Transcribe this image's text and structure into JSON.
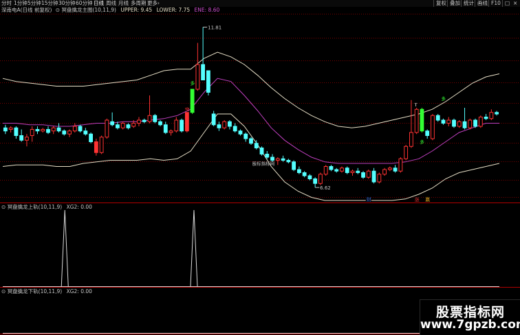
{
  "toolbar": {
    "periods": [
      "分时",
      "1分钟",
      "5分钟",
      "15分钟",
      "30分钟",
      "60分钟",
      "日线",
      "周线",
      "月线",
      "多周期",
      "更多"
    ],
    "active_period": "日线",
    "more_arrow": "›",
    "actions": [
      "复权",
      "叠加",
      "统计",
      "画线",
      "F10"
    ],
    "window_controls": [
      "□",
      "×"
    ]
  },
  "main_panel": {
    "stock_label": "深南电A(日线 前复权)",
    "indicator_name": "冥盘擒龙主图(10,11,9)",
    "upper_label": "UPPER: 9.45",
    "lower_label": "LOWER: 7.75",
    "ene_label": "ENE: 8.60",
    "high_annotation": "11.81",
    "low_annotation": "6.62",
    "watermark_in_chart": "股标指标网",
    "signal_labels": [
      {
        "text": "多",
        "color": "#33ff33"
      },
      {
        "text": "空",
        "color": "#ff3333"
      },
      {
        "text": "多",
        "color": "#33ff33"
      },
      {
        "text": "T",
        "color": "#ffffff"
      },
      {
        "text": "多",
        "color": "#33ff33"
      }
    ],
    "bottom_markers": [
      {
        "text": "财",
        "color": "#3b6dd6"
      },
      {
        "text": "涨",
        "color": "#e03030"
      },
      {
        "text": "赢",
        "color": "#e0a020"
      }
    ]
  },
  "sub_panel_1": {
    "title": "冥盘擒龙上轨(10,11,9)",
    "value_label": "XG2: 0.00"
  },
  "sub_panel_2": {
    "title": "冥盘擒龙下轨(10,11,9)",
    "value_label": "XG2: 0.00"
  },
  "colors": {
    "up": "#ff3333",
    "down": "#54ffff",
    "signal_up": "#33ff33",
    "band": "#e8e0c8",
    "ene": "#c040c0",
    "grid": "#8b0000"
  },
  "watermark": {
    "line1": "股票指标网",
    "line2": "www.7gpzb.com"
  },
  "chart_data": {
    "type": "candlestick",
    "price_range": [
      6.2,
      12.2
    ],
    "high_marker": 11.81,
    "low_marker": 6.62,
    "candles": [
      {
        "o": 8.55,
        "h": 8.65,
        "l": 8.35,
        "c": 8.45
      },
      {
        "o": 8.5,
        "h": 8.6,
        "l": 8.4,
        "c": 8.55
      },
      {
        "o": 8.55,
        "h": 8.6,
        "l": 8.2,
        "c": 8.3
      },
      {
        "o": 8.3,
        "h": 8.5,
        "l": 8.1,
        "c": 8.15
      },
      {
        "o": 8.15,
        "h": 8.35,
        "l": 7.95,
        "c": 8.25
      },
      {
        "o": 8.3,
        "h": 8.6,
        "l": 8.1,
        "c": 8.5
      },
      {
        "o": 8.5,
        "h": 8.6,
        "l": 8.35,
        "c": 8.45
      },
      {
        "o": 8.45,
        "h": 8.55,
        "l": 8.4,
        "c": 8.5
      },
      {
        "o": 8.5,
        "h": 8.6,
        "l": 8.35,
        "c": 8.4
      },
      {
        "o": 8.45,
        "h": 8.6,
        "l": 8.35,
        "c": 8.55
      },
      {
        "o": 8.55,
        "h": 8.7,
        "l": 8.4,
        "c": 8.45
      },
      {
        "o": 8.45,
        "h": 8.5,
        "l": 8.3,
        "c": 8.35
      },
      {
        "o": 8.35,
        "h": 8.5,
        "l": 8.25,
        "c": 8.45
      },
      {
        "o": 8.45,
        "h": 8.7,
        "l": 8.4,
        "c": 8.6
      },
      {
        "o": 8.6,
        "h": 8.65,
        "l": 8.4,
        "c": 8.45
      },
      {
        "o": 8.45,
        "h": 8.55,
        "l": 8.3,
        "c": 8.35
      },
      {
        "o": 8.35,
        "h": 8.4,
        "l": 8.05,
        "c": 8.1
      },
      {
        "o": 8.1,
        "h": 8.2,
        "l": 7.65,
        "c": 7.75
      },
      {
        "o": 7.75,
        "h": 8.3,
        "l": 7.7,
        "c": 8.25
      },
      {
        "o": 8.25,
        "h": 8.85,
        "l": 8.2,
        "c": 8.8
      },
      {
        "o": 8.75,
        "h": 9.05,
        "l": 8.6,
        "c": 8.65
      },
      {
        "o": 8.65,
        "h": 8.75,
        "l": 8.5,
        "c": 8.55
      },
      {
        "o": 8.55,
        "h": 8.75,
        "l": 8.5,
        "c": 8.7
      },
      {
        "o": 8.65,
        "h": 8.7,
        "l": 8.5,
        "c": 8.55
      },
      {
        "o": 8.6,
        "h": 8.8,
        "l": 8.55,
        "c": 8.7
      },
      {
        "o": 8.7,
        "h": 8.9,
        "l": 8.6,
        "c": 8.8
      },
      {
        "o": 8.8,
        "h": 8.85,
        "l": 8.7,
        "c": 8.75
      },
      {
        "o": 8.75,
        "h": 9.6,
        "l": 8.7,
        "c": 8.95
      },
      {
        "o": 8.95,
        "h": 9.0,
        "l": 8.7,
        "c": 8.75
      },
      {
        "o": 8.75,
        "h": 8.8,
        "l": 8.6,
        "c": 8.65
      },
      {
        "o": 8.65,
        "h": 8.75,
        "l": 8.35,
        "c": 8.4
      },
      {
        "o": 8.4,
        "h": 8.5,
        "l": 8.3,
        "c": 8.45
      },
      {
        "o": 8.45,
        "h": 8.9,
        "l": 8.4,
        "c": 8.8
      },
      {
        "o": 8.8,
        "h": 8.85,
        "l": 8.4,
        "c": 8.45
      },
      {
        "o": 8.45,
        "h": 9.05,
        "l": 8.4,
        "c": 9.05
      },
      {
        "o": 9.05,
        "h": 9.8,
        "l": 9.0,
        "c": 9.8
      },
      {
        "o": 9.8,
        "h": 11.3,
        "l": 9.75,
        "c": 10.6
      },
      {
        "o": 10.6,
        "h": 11.81,
        "l": 10.1,
        "c": 10.1
      },
      {
        "o": 10.4,
        "h": 10.4,
        "l": 9.6,
        "c": 9.7
      },
      {
        "o": 9.0,
        "h": 9.1,
        "l": 8.6,
        "c": 8.65
      },
      {
        "o": 8.65,
        "h": 8.75,
        "l": 8.45,
        "c": 8.55
      },
      {
        "o": 8.55,
        "h": 8.8,
        "l": 8.5,
        "c": 8.75
      },
      {
        "o": 8.75,
        "h": 8.8,
        "l": 8.5,
        "c": 8.6
      },
      {
        "o": 8.6,
        "h": 8.7,
        "l": 8.4,
        "c": 8.45
      },
      {
        "o": 8.45,
        "h": 8.5,
        "l": 8.3,
        "c": 8.35
      },
      {
        "o": 8.35,
        "h": 8.4,
        "l": 8.1,
        "c": 8.2
      },
      {
        "o": 8.2,
        "h": 8.25,
        "l": 8.0,
        "c": 8.05
      },
      {
        "o": 8.05,
        "h": 8.15,
        "l": 7.85,
        "c": 7.9
      },
      {
        "o": 7.9,
        "h": 7.95,
        "l": 7.65,
        "c": 7.7
      },
      {
        "o": 7.7,
        "h": 7.8,
        "l": 7.55,
        "c": 7.6
      },
      {
        "o": 7.6,
        "h": 7.7,
        "l": 7.45,
        "c": 7.5
      },
      {
        "o": 7.5,
        "h": 7.6,
        "l": 7.35,
        "c": 7.55
      },
      {
        "o": 7.55,
        "h": 7.65,
        "l": 7.45,
        "c": 7.5
      },
      {
        "o": 7.5,
        "h": 7.55,
        "l": 7.4,
        "c": 7.45
      },
      {
        "o": 7.45,
        "h": 7.5,
        "l": 7.15,
        "c": 7.2
      },
      {
        "o": 7.2,
        "h": 7.3,
        "l": 7.05,
        "c": 7.1
      },
      {
        "o": 7.1,
        "h": 7.15,
        "l": 6.95,
        "c": 7.0
      },
      {
        "o": 7.0,
        "h": 7.05,
        "l": 6.85,
        "c": 6.9
      },
      {
        "o": 6.9,
        "h": 6.95,
        "l": 6.62,
        "c": 6.75
      },
      {
        "o": 6.75,
        "h": 7.1,
        "l": 6.7,
        "c": 7.05
      },
      {
        "o": 7.05,
        "h": 7.35,
        "l": 7.0,
        "c": 7.3
      },
      {
        "o": 7.3,
        "h": 7.35,
        "l": 7.15,
        "c": 7.2
      },
      {
        "o": 7.2,
        "h": 7.25,
        "l": 7.1,
        "c": 7.15
      },
      {
        "o": 7.15,
        "h": 7.3,
        "l": 7.1,
        "c": 7.25
      },
      {
        "o": 7.25,
        "h": 7.3,
        "l": 7.05,
        "c": 7.1
      },
      {
        "o": 7.1,
        "h": 7.2,
        "l": 7.0,
        "c": 7.15
      },
      {
        "o": 7.15,
        "h": 7.25,
        "l": 7.05,
        "c": 7.1
      },
      {
        "o": 7.1,
        "h": 7.15,
        "l": 6.9,
        "c": 6.95
      },
      {
        "o": 6.95,
        "h": 7.2,
        "l": 6.9,
        "c": 7.15
      },
      {
        "o": 7.15,
        "h": 7.25,
        "l": 6.75,
        "c": 6.8
      },
      {
        "o": 6.8,
        "h": 7.1,
        "l": 6.75,
        "c": 7.05
      },
      {
        "o": 7.05,
        "h": 7.25,
        "l": 7.0,
        "c": 7.2
      },
      {
        "o": 7.2,
        "h": 7.3,
        "l": 7.15,
        "c": 7.25
      },
      {
        "o": 7.25,
        "h": 7.35,
        "l": 7.1,
        "c": 7.15
      },
      {
        "o": 7.15,
        "h": 7.6,
        "l": 7.1,
        "c": 7.55
      },
      {
        "o": 7.55,
        "h": 8.0,
        "l": 7.5,
        "c": 7.95
      },
      {
        "o": 7.95,
        "h": 9.45,
        "l": 7.9,
        "c": 8.4
      },
      {
        "o": 8.4,
        "h": 9.2,
        "l": 8.35,
        "c": 9.15
      },
      {
        "o": 9.15,
        "h": 9.2,
        "l": 8.4,
        "c": 8.45
      },
      {
        "o": 8.45,
        "h": 8.5,
        "l": 8.2,
        "c": 8.3
      },
      {
        "o": 8.2,
        "h": 9.0,
        "l": 8.15,
        "c": 8.95
      },
      {
        "o": 8.95,
        "h": 9.0,
        "l": 8.75,
        "c": 8.8
      },
      {
        "o": 8.8,
        "h": 8.85,
        "l": 8.65,
        "c": 8.7
      },
      {
        "o": 8.7,
        "h": 8.9,
        "l": 8.6,
        "c": 8.8
      },
      {
        "o": 8.8,
        "h": 8.85,
        "l": 8.55,
        "c": 8.6
      },
      {
        "o": 8.6,
        "h": 8.8,
        "l": 8.55,
        "c": 8.75
      },
      {
        "o": 8.75,
        "h": 9.2,
        "l": 8.5,
        "c": 8.55
      },
      {
        "o": 8.55,
        "h": 8.85,
        "l": 8.5,
        "c": 8.8
      },
      {
        "o": 8.8,
        "h": 8.85,
        "l": 8.55,
        "c": 8.6
      },
      {
        "o": 8.6,
        "h": 8.95,
        "l": 8.55,
        "c": 8.9
      },
      {
        "o": 8.9,
        "h": 9.0,
        "l": 8.8,
        "c": 8.85
      },
      {
        "o": 8.85,
        "h": 9.15,
        "l": 8.8,
        "c": 9.05
      },
      {
        "o": 9.05,
        "h": 9.1,
        "l": 8.95,
        "c": 9.0
      }
    ],
    "upper_band": [
      10.15,
      10.05,
      10.0,
      9.95,
      9.9,
      9.9,
      9.9,
      9.95,
      10.0,
      10.05,
      10.1,
      10.25,
      10.4,
      10.45,
      10.45,
      10.8,
      11.0,
      10.85,
      10.6,
      10.25,
      9.85,
      9.5,
      9.2,
      8.95,
      8.75,
      8.6,
      8.55,
      8.6,
      8.7,
      8.8,
      8.9,
      9.0,
      9.15,
      9.4,
      9.7,
      10.0,
      10.2,
      10.3
    ],
    "ene_line": [
      8.7,
      8.7,
      8.65,
      8.65,
      8.6,
      8.6,
      8.65,
      8.7,
      8.7,
      8.75,
      8.75,
      8.8,
      8.85,
      8.95,
      9.15,
      9.7,
      10.15,
      10.05,
      9.6,
      9.1,
      8.55,
      8.15,
      7.85,
      7.6,
      7.45,
      7.4,
      7.4,
      7.4,
      7.4,
      7.4,
      7.45,
      7.55,
      7.8,
      8.1,
      8.4,
      8.55,
      8.7,
      8.7
    ],
    "lower_band": [
      7.3,
      7.35,
      7.35,
      7.35,
      7.3,
      7.3,
      7.4,
      7.45,
      7.5,
      7.5,
      7.5,
      7.55,
      7.5,
      7.55,
      7.8,
      8.4,
      9.0,
      9.0,
      8.6,
      8.0,
      7.3,
      6.8,
      6.5,
      6.3,
      6.2,
      6.2,
      6.2,
      6.2,
      6.2,
      6.2,
      6.25,
      6.4,
      6.6,
      6.9,
      7.1,
      7.2,
      7.3,
      7.4
    ],
    "xg2_upper_spikes": [
      {
        "index": 11,
        "value": 1
      },
      {
        "index": 37,
        "value": 1
      }
    ],
    "xg2_upper_range": [
      0,
      1
    ],
    "xg2_lower_value": 0
  }
}
